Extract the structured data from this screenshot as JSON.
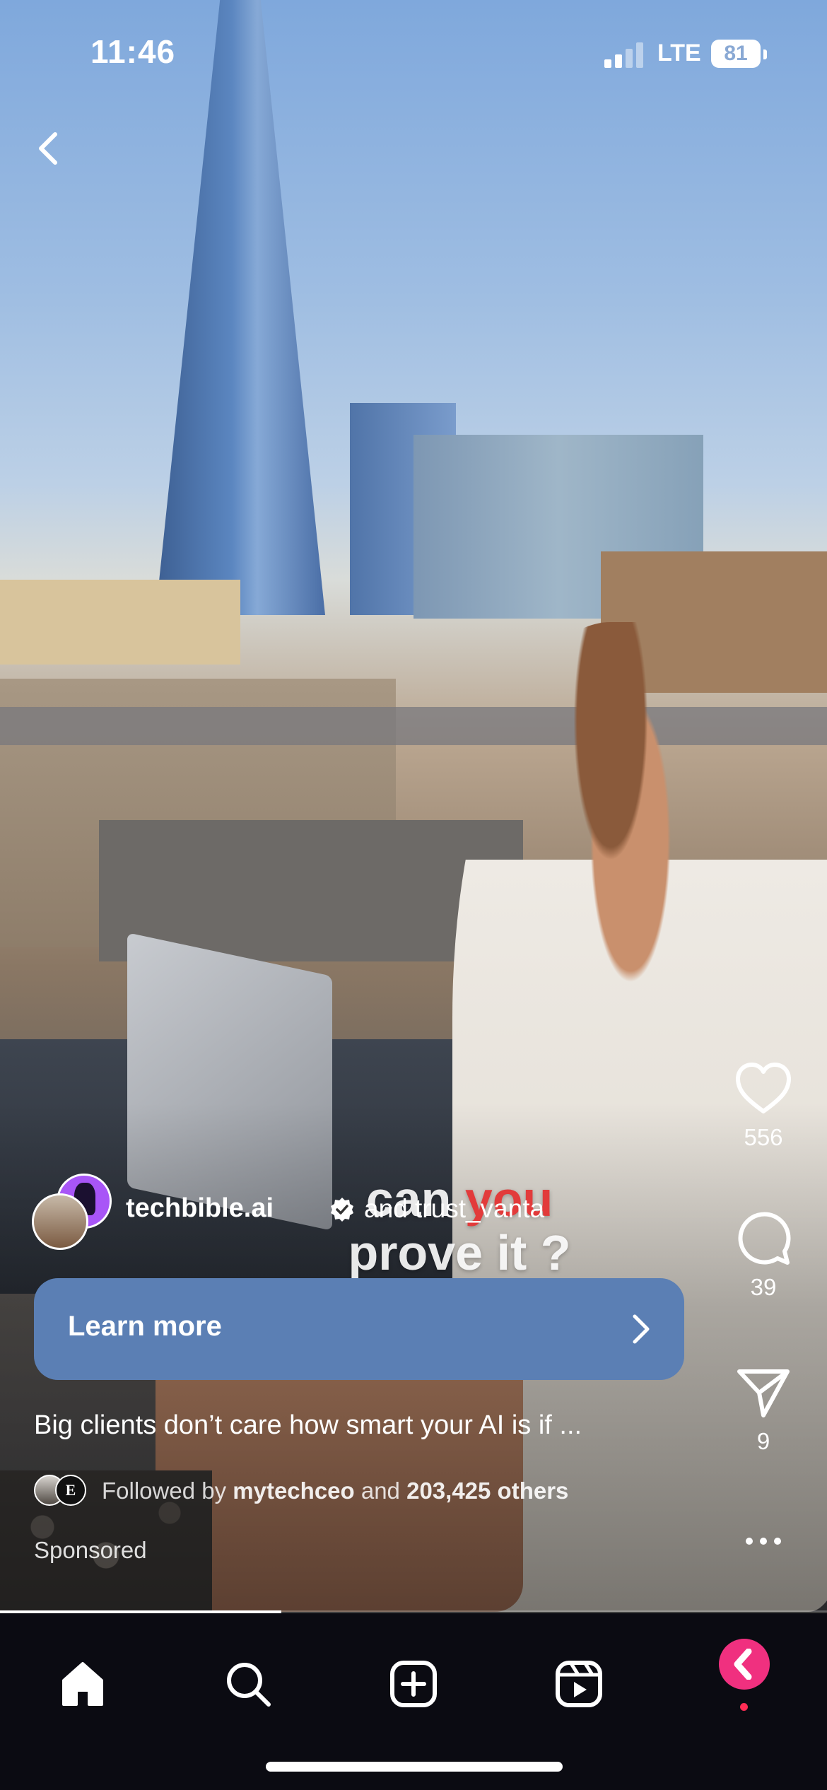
{
  "status_bar": {
    "time": "11:46",
    "network": "LTE",
    "battery": "81"
  },
  "video": {
    "overlay_caption": {
      "line1_a": "can ",
      "line1_b": "you",
      "line2": "prove it ?"
    },
    "playback_progress": 0.34
  },
  "post": {
    "author": "techbible.ai",
    "verified": true,
    "coauthor_text": "and trust_vanta",
    "cta_label": "Learn more",
    "caption": "Big clients don’t care how smart your AI is if ...",
    "followed_by_prefix": "Followed by ",
    "followed_by_user": "mytechceo",
    "followed_by_mid": " and ",
    "followed_by_count": "203,425 others",
    "sponsored_label": "Sponsored",
    "mini_avatar_letter": "E"
  },
  "actions": {
    "likes": "556",
    "comments": "39",
    "shares": "9"
  },
  "tabbar": {
    "items": [
      "home-icon",
      "search-icon",
      "create-icon",
      "reels-icon",
      "profile-icon"
    ]
  },
  "colors": {
    "cta": "#5b7fb4",
    "accent_red": "#e23b3b",
    "profile": "#f0307f",
    "tabbar": "#0b0b12"
  }
}
